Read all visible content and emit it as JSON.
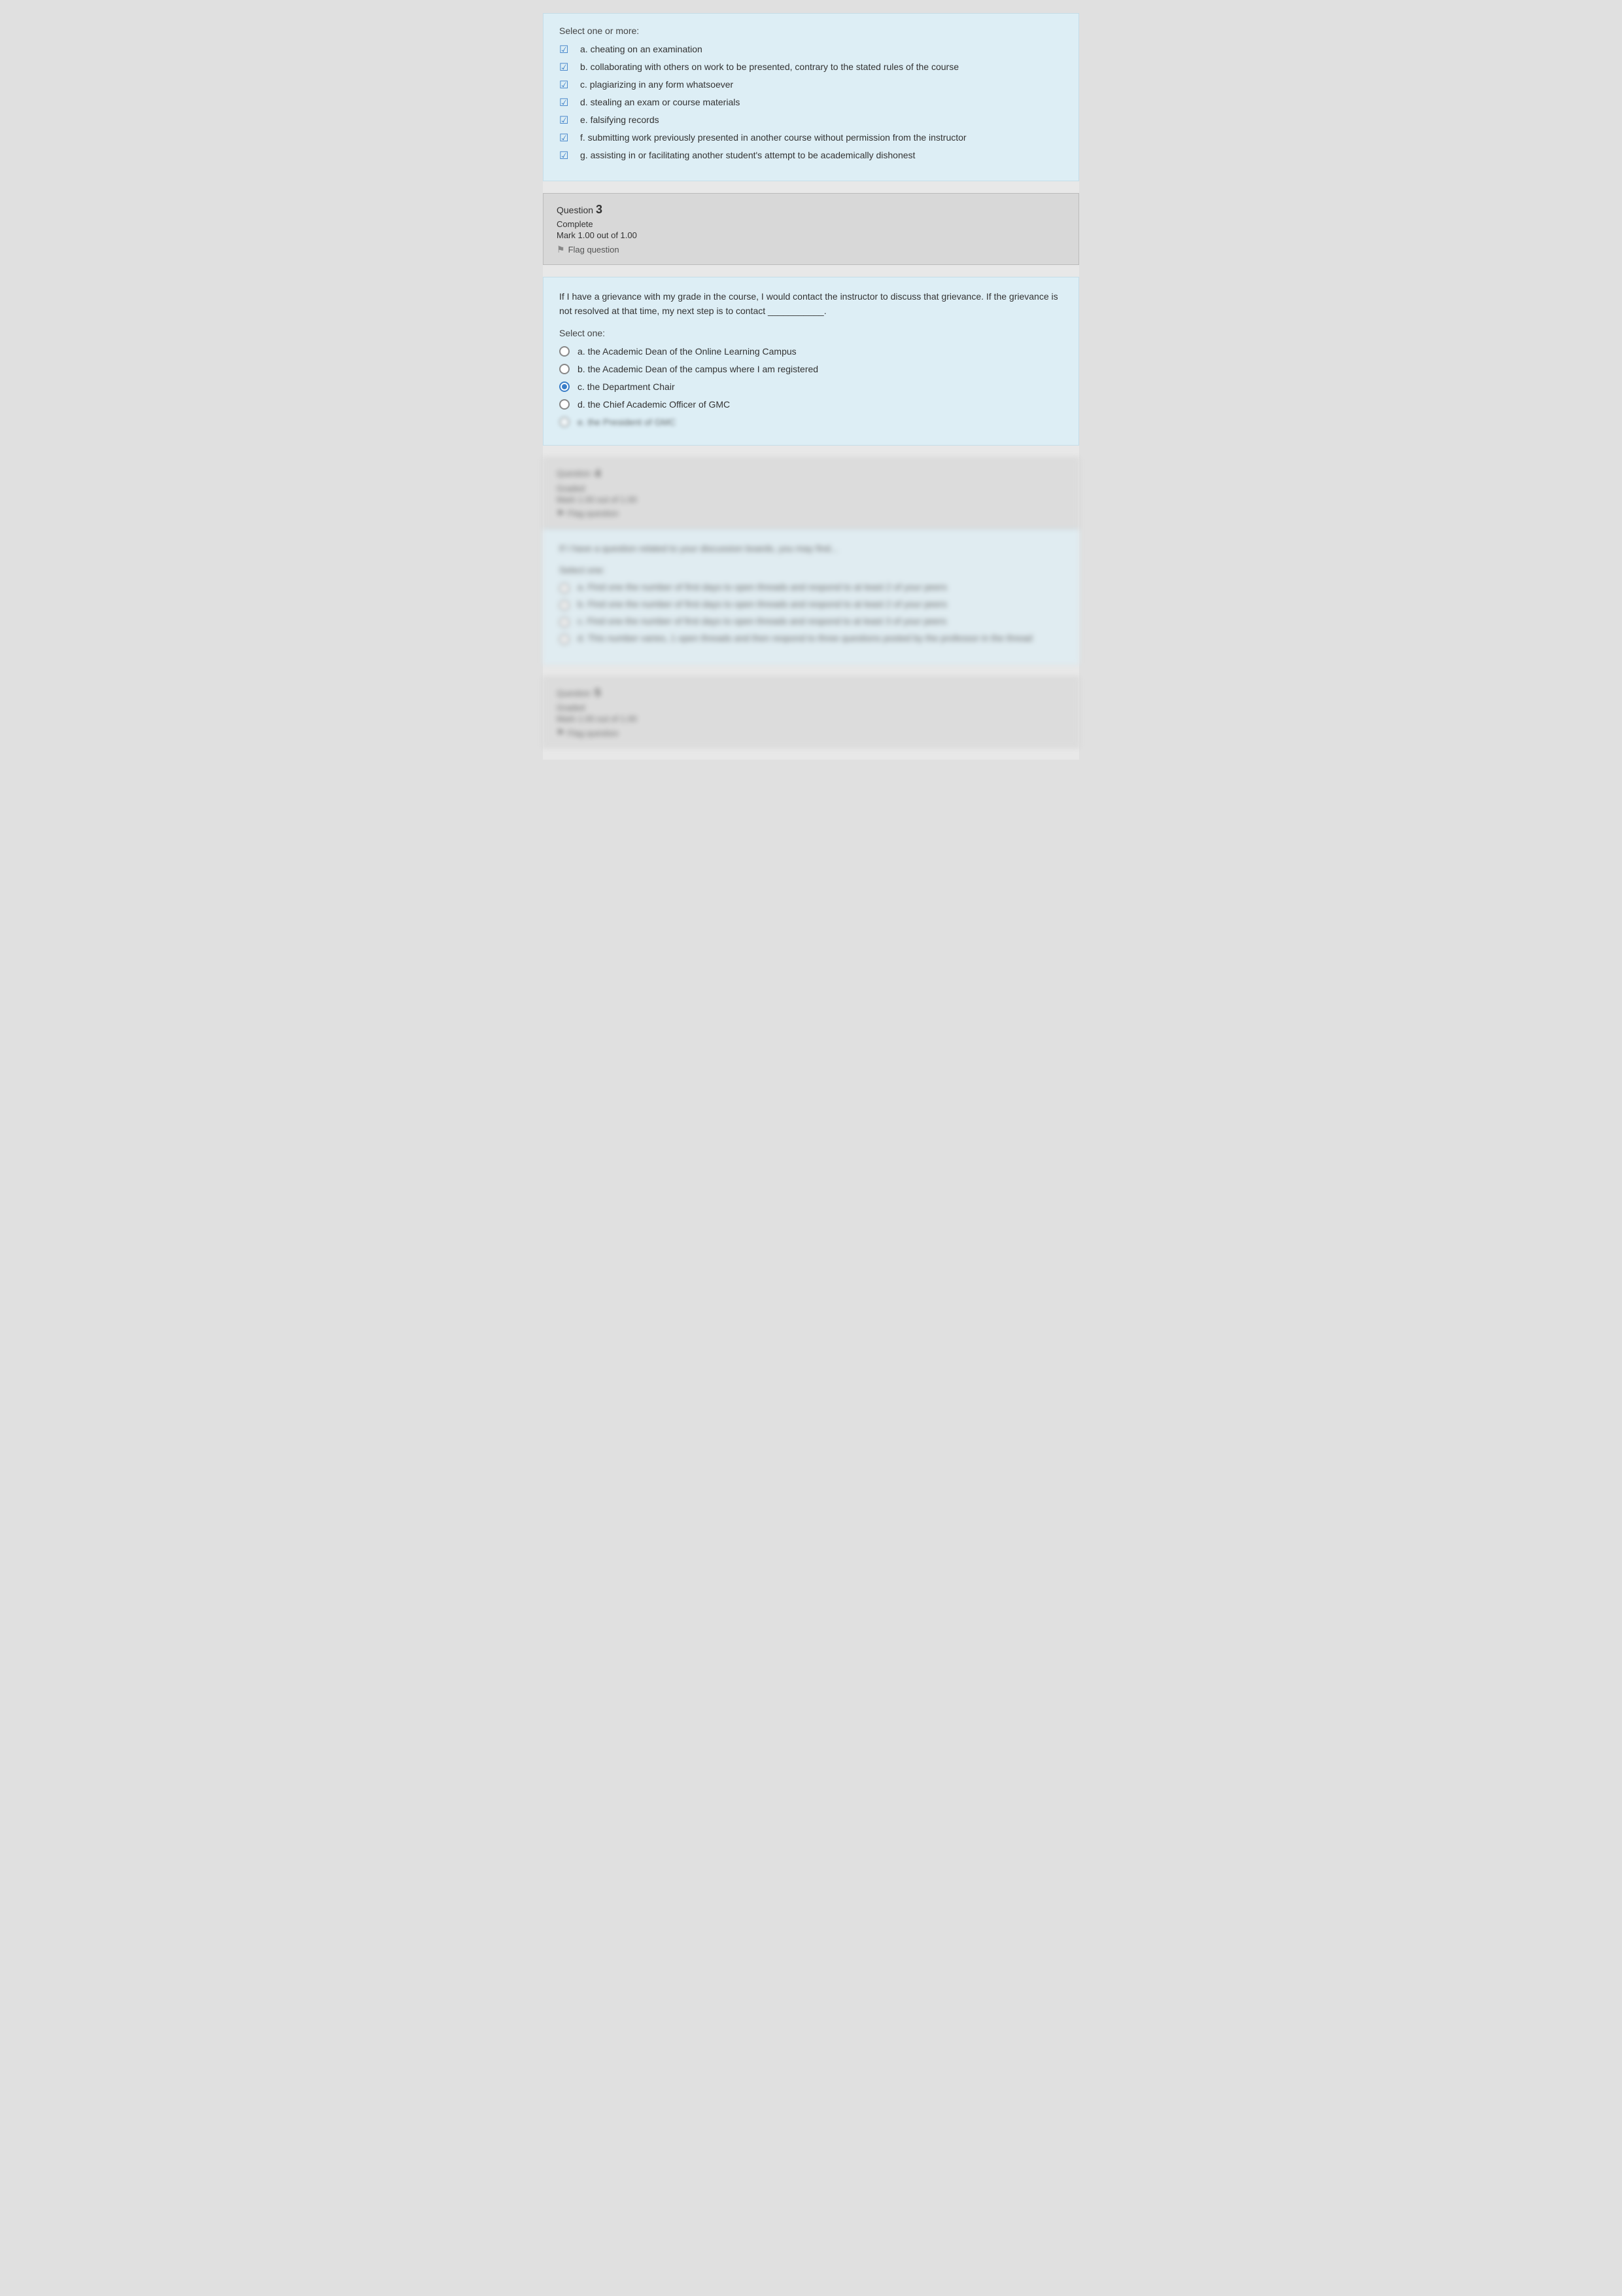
{
  "q2": {
    "answer_block": {
      "select_label": "Select one or more:",
      "options": [
        {
          "id": "a",
          "text": "a. cheating on an examination",
          "checked": true
        },
        {
          "id": "b",
          "text": "b. collaborating with others on work to be presented, contrary to the stated rules of the course",
          "checked": true
        },
        {
          "id": "c",
          "text": "c. plagiarizing in any form whatsoever",
          "checked": true
        },
        {
          "id": "d",
          "text": "d. stealing an exam or course materials",
          "checked": true
        },
        {
          "id": "e",
          "text": "e. falsifying records",
          "checked": true
        },
        {
          "id": "f",
          "text": "f. submitting work previously presented in another course without permission from the instructor",
          "checked": true
        },
        {
          "id": "g",
          "text": "g. assisting in or facilitating another student's attempt to be academically dishonest",
          "checked": true
        }
      ]
    }
  },
  "q3": {
    "info_block": {
      "question_label": "Question",
      "question_number": "3",
      "status": "Complete",
      "mark": "Mark 1.00 out of 1.00",
      "flag_label": "Flag question"
    },
    "question_block": {
      "body": "If I have a grievance with my grade in the course, I would contact the instructor to discuss that grievance. If the grievance is not resolved at that time, my next step is to contact ___________.",
      "select_label": "Select one:",
      "options": [
        {
          "id": "a",
          "text": "a. the Academic Dean of the Online Learning Campus",
          "selected": false
        },
        {
          "id": "b",
          "text": "b. the Academic Dean of the campus where I am registered",
          "selected": false
        },
        {
          "id": "c",
          "text": "c. the Department Chair",
          "selected": true
        },
        {
          "id": "d",
          "text": "d. the Chief Academic Officer of GMC",
          "selected": false
        },
        {
          "id": "e",
          "text": "e. [blurred option]",
          "selected": false,
          "blurred": true
        }
      ]
    }
  },
  "q4_blurred": {
    "info_block": {
      "question_label": "Question",
      "question_number": "4",
      "status": "Graded",
      "mark": "Mark 1.00 out of 1.00",
      "flag_label": "Flag question"
    },
    "question_block": {
      "body": "If I have a question related to your discussion boards, you may find...",
      "select_label": "Select one:",
      "options": [
        {
          "id": "a",
          "text": "a. Find one the number of first days to open threads and respond to at least 2 of your peers"
        },
        {
          "id": "b",
          "text": "b. Find one the number of first days to open threads and respond to at least 2 of your peers"
        },
        {
          "id": "c",
          "text": "c. Find one the number of first days to open threads and respond to at least 3 of your peers"
        },
        {
          "id": "d",
          "text": "d. This number varies, 1 open threads and then respond to three questions posted by the professor in the thread"
        }
      ]
    }
  },
  "q5_blurred": {
    "info_block": {
      "question_label": "Question",
      "question_number": "5",
      "status": "Graded",
      "mark": "Mark 1.00 out of 1.00",
      "flag_label": "Flag question"
    }
  }
}
